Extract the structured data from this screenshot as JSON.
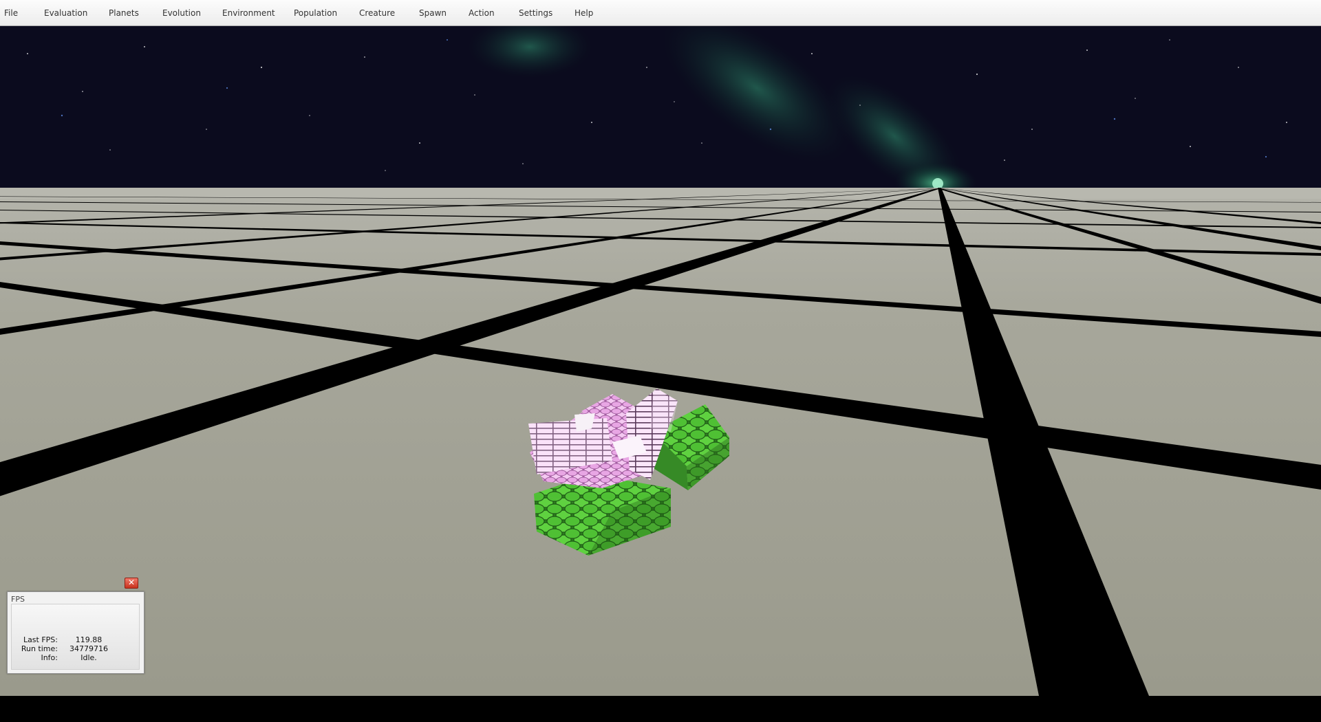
{
  "menu": {
    "items": [
      {
        "label": "File",
        "name": "menu-file"
      },
      {
        "label": "Evaluation",
        "name": "menu-evaluation"
      },
      {
        "label": "Planets",
        "name": "menu-planets"
      },
      {
        "label": "Evolution",
        "name": "menu-evolution"
      },
      {
        "label": "Environment",
        "name": "menu-environment"
      },
      {
        "label": "Population",
        "name": "menu-population"
      },
      {
        "label": "Creature",
        "name": "menu-creature"
      },
      {
        "label": "Spawn",
        "name": "menu-spawn"
      },
      {
        "label": "Action",
        "name": "menu-action"
      },
      {
        "label": "Settings",
        "name": "menu-settings"
      },
      {
        "label": "Help",
        "name": "menu-help"
      }
    ]
  },
  "fps_panel": {
    "title": "FPS",
    "close_icon": "close-icon",
    "rows": [
      {
        "label": "Last FPS:",
        "value": "119.88"
      },
      {
        "label": "Run time:",
        "value": "34779716"
      },
      {
        "label": "Info:",
        "value": "Idle."
      }
    ]
  },
  "colors": {
    "sky": "#0a0a1c",
    "nebula": "#2f8a66",
    "ground": "#9c9c8e",
    "grid_line": "#000000",
    "creature_green": "#5ac83c",
    "creature_pink": "#e79ae3"
  }
}
